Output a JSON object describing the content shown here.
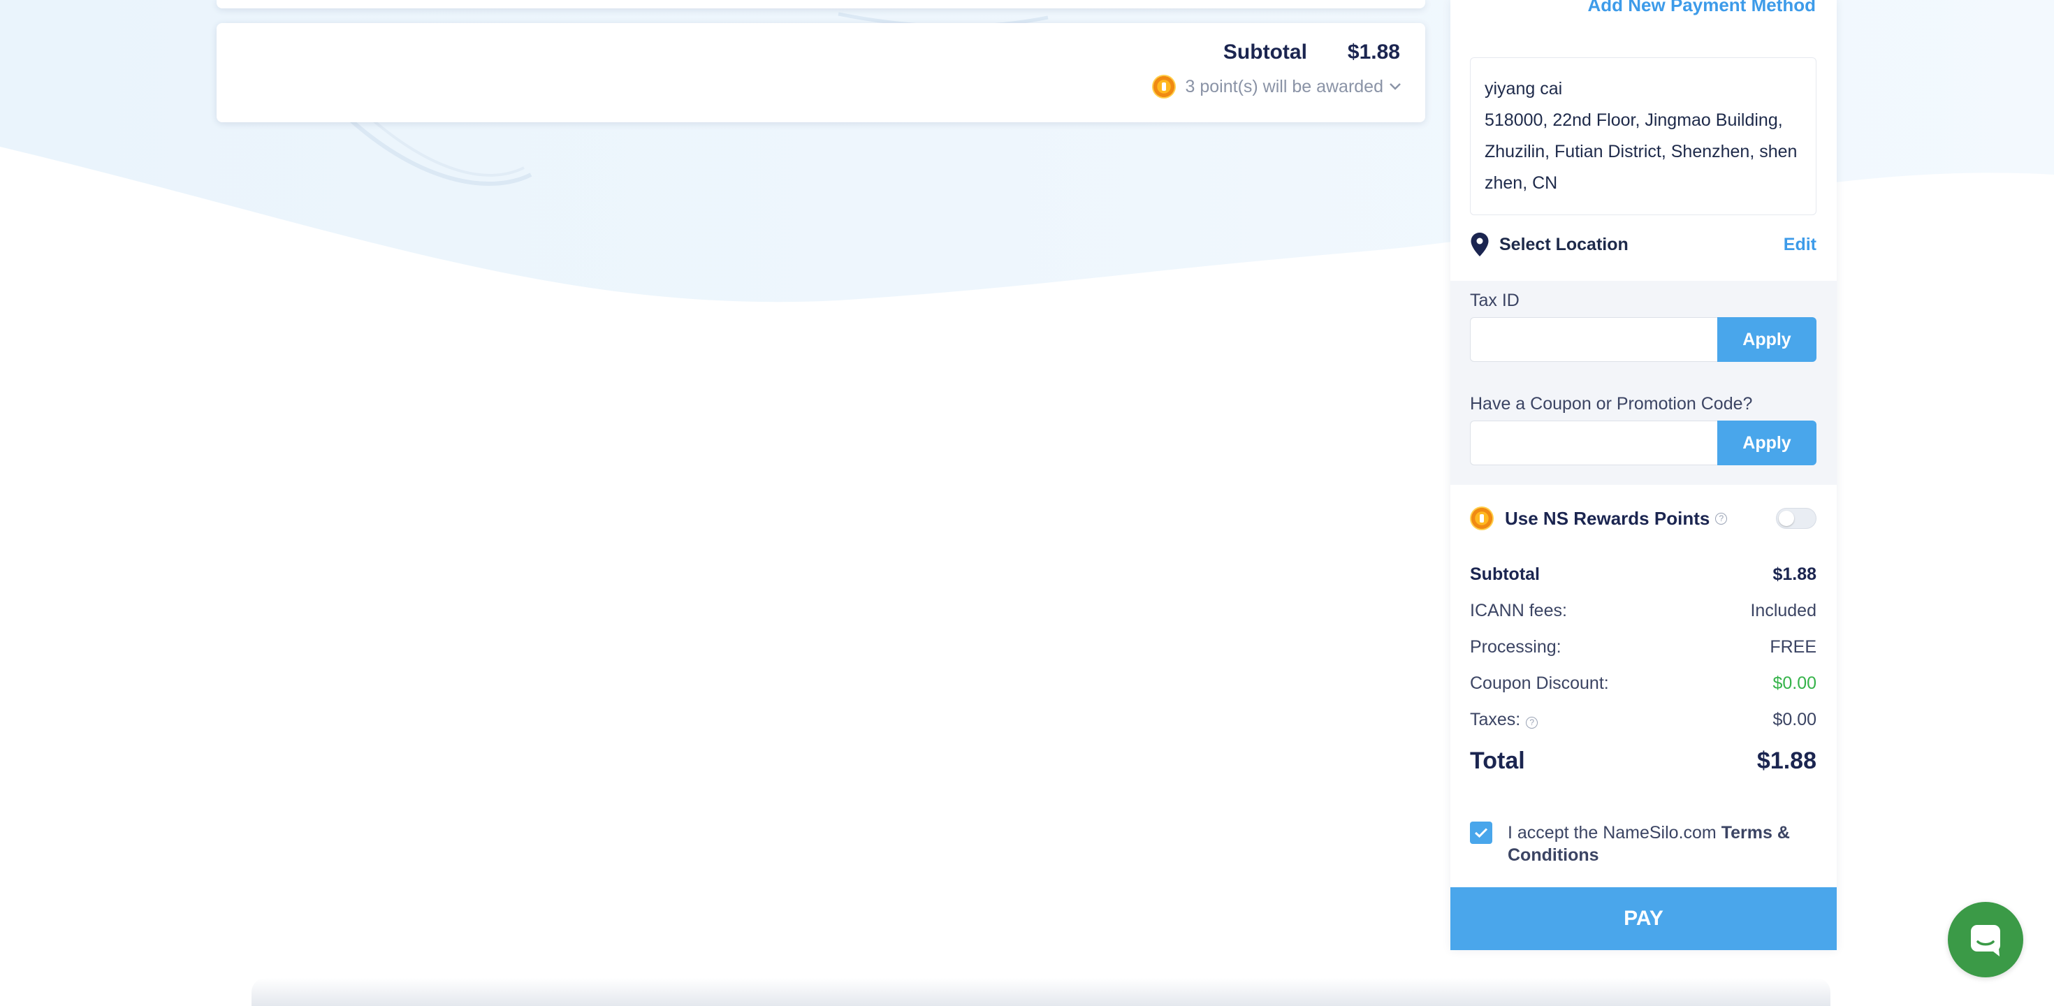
{
  "cart": {
    "subtotal_label": "Subtotal",
    "subtotal_value": "$1.88",
    "points_text": "3 point(s) will be awarded"
  },
  "payment": {
    "add_payment_method": "Add New Payment Method",
    "address": {
      "name": "yiyang cai",
      "line1": "518000, 22nd Floor, Jingmao Building,",
      "line2": "Zhuzilin, Futian District, Shenzhen, shen",
      "line3": "zhen, CN"
    },
    "select_location": "Select Location",
    "edit": "Edit"
  },
  "tax": {
    "label": "Tax ID",
    "value": "",
    "apply": "Apply"
  },
  "coupon": {
    "label": "Have a Coupon or Promotion Code?",
    "value": "",
    "apply": "Apply"
  },
  "rewards": {
    "label": "Use NS Rewards Points",
    "help": "?",
    "enabled": false
  },
  "summary": {
    "subtotal_label": "Subtotal",
    "subtotal_value": "$1.88",
    "icann_label": "ICANN fees:",
    "icann_value": "Included",
    "processing_label": "Processing:",
    "processing_value": "FREE",
    "coupon_label": "Coupon Discount:",
    "coupon_value": "$0.00",
    "taxes_label": "Taxes:",
    "taxes_help": "?",
    "taxes_value": "$0.00",
    "total_label": "Total",
    "total_value": "$1.88"
  },
  "terms": {
    "checked": true,
    "text": "I accept the NameSilo.com ",
    "link": "Terms & Conditions"
  },
  "pay_button": "PAY",
  "colors": {
    "accent": "#4aa6eb",
    "navy": "#1b2550",
    "green": "#35b34a",
    "chat": "#3b9a47"
  },
  "icons": {
    "coin": "reward-coin-icon",
    "pin": "location-pin-icon",
    "chat": "chat-icon"
  }
}
